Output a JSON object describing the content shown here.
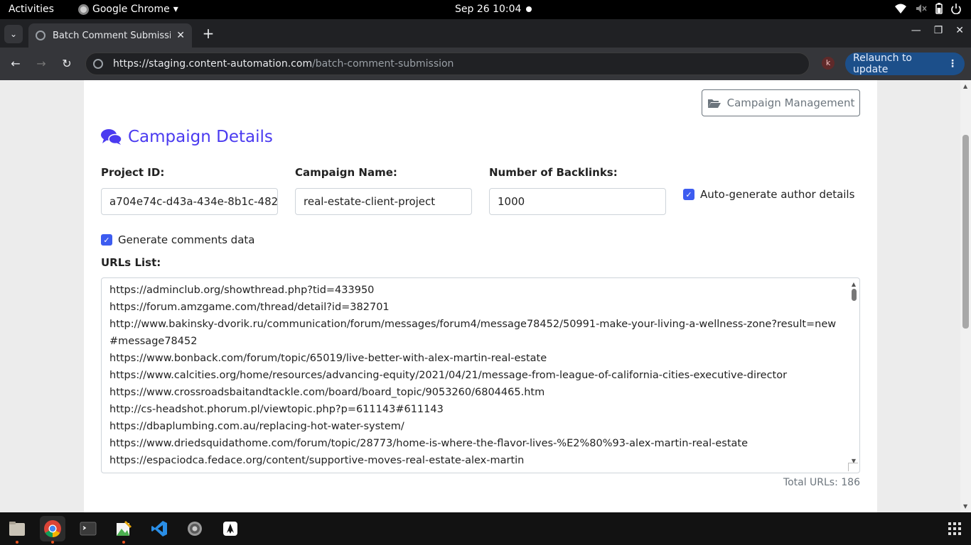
{
  "topbar": {
    "activities": "Activities",
    "app_name": "Google Chrome",
    "clock": "Sep 26  10:04",
    "tray_icons": [
      "wifi-icon",
      "volume-muted-icon",
      "battery-icon",
      "power-icon"
    ]
  },
  "browser": {
    "tab_title": "Batch Comment Submission",
    "url_host": "https://staging.content-automation.com",
    "url_path": "/batch-comment-submission",
    "profile_initial": "k",
    "relaunch_label": "Relaunch to update"
  },
  "page": {
    "campaign_management_label": "Campaign Management",
    "section_title": "Campaign Details",
    "project_id_label": "Project ID:",
    "project_id_value": "a704e74c-d43a-434e-8b1c-482",
    "campaign_name_label": "Campaign Name:",
    "campaign_name_value": "real-estate-client-project",
    "backlinks_label": "Number of Backlinks:",
    "backlinks_value": "1000",
    "auto_author_label": "Auto-generate author details",
    "auto_author_checked": true,
    "generate_comments_label": "Generate comments data",
    "generate_comments_checked": true,
    "urls_label": "URLs List:",
    "urls": [
      "https://adminclub.org/showthread.php?tid=433950",
      "https://forum.amzgame.com/thread/detail?id=382701",
      "http://www.bakinsky-dvorik.ru/communication/forum/messages/forum4/message78452/50991-make-your-living-a-wellness-zone?result=new#message78452",
      "https://www.bonback.com/forum/topic/65019/live-better-with-alex-martin-real-estate",
      "https://www.calcities.org/home/resources/advancing-equity/2021/04/21/message-from-league-of-california-cities-executive-director",
      "https://www.crossroadsbaitandtackle.com/board/board_topic/9053260/6804465.htm",
      "http://cs-headshot.phorum.pl/viewtopic.php?p=611143#611143",
      "https://dbaplumbing.com.au/replacing-hot-water-system/",
      "https://www.driedsquidathome.com/forum/topic/28773/home-is-where-the-flavor-lives-%E2%80%93-alex-martin-real-estate",
      "https://espaciodca.fedace.org/content/supportive-moves-real-estate-alex-martin"
    ],
    "total_urls": "Total URLs: 186"
  },
  "dock": [
    "files-icon",
    "chrome-icon",
    "terminal-icon",
    "image-editor-icon",
    "vscode-icon",
    "settings-icon",
    "inkscape-icon"
  ]
}
